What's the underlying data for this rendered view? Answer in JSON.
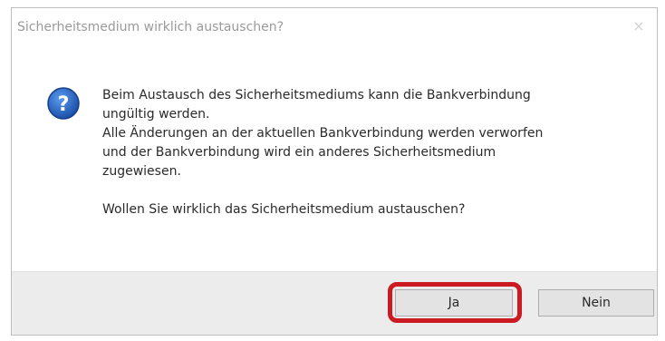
{
  "window": {
    "title": "Sicherheitsmedium wirklich austauschen?",
    "close_glyph": "×",
    "close_icon": "close-icon"
  },
  "icon": {
    "name": "question-icon",
    "glyph": "?",
    "color": "#1f5fc2"
  },
  "message": {
    "line1": "Beim Austausch des Sicherheitsmediums kann die Bankverbindung",
    "line2": "ungültig werden.",
    "line3": "Alle Änderungen an der aktuellen Bankverbindung werden verworfen",
    "line4": "und der Bankverbindung wird ein anderes Sicherheitsmedium",
    "line5": "zugewiesen.",
    "question": "Wollen Sie wirklich das Sicherheitsmedium austauschen?"
  },
  "buttons": {
    "yes_label": "Ja",
    "no_label": "Nein"
  },
  "highlight_color": "#cc1a22"
}
